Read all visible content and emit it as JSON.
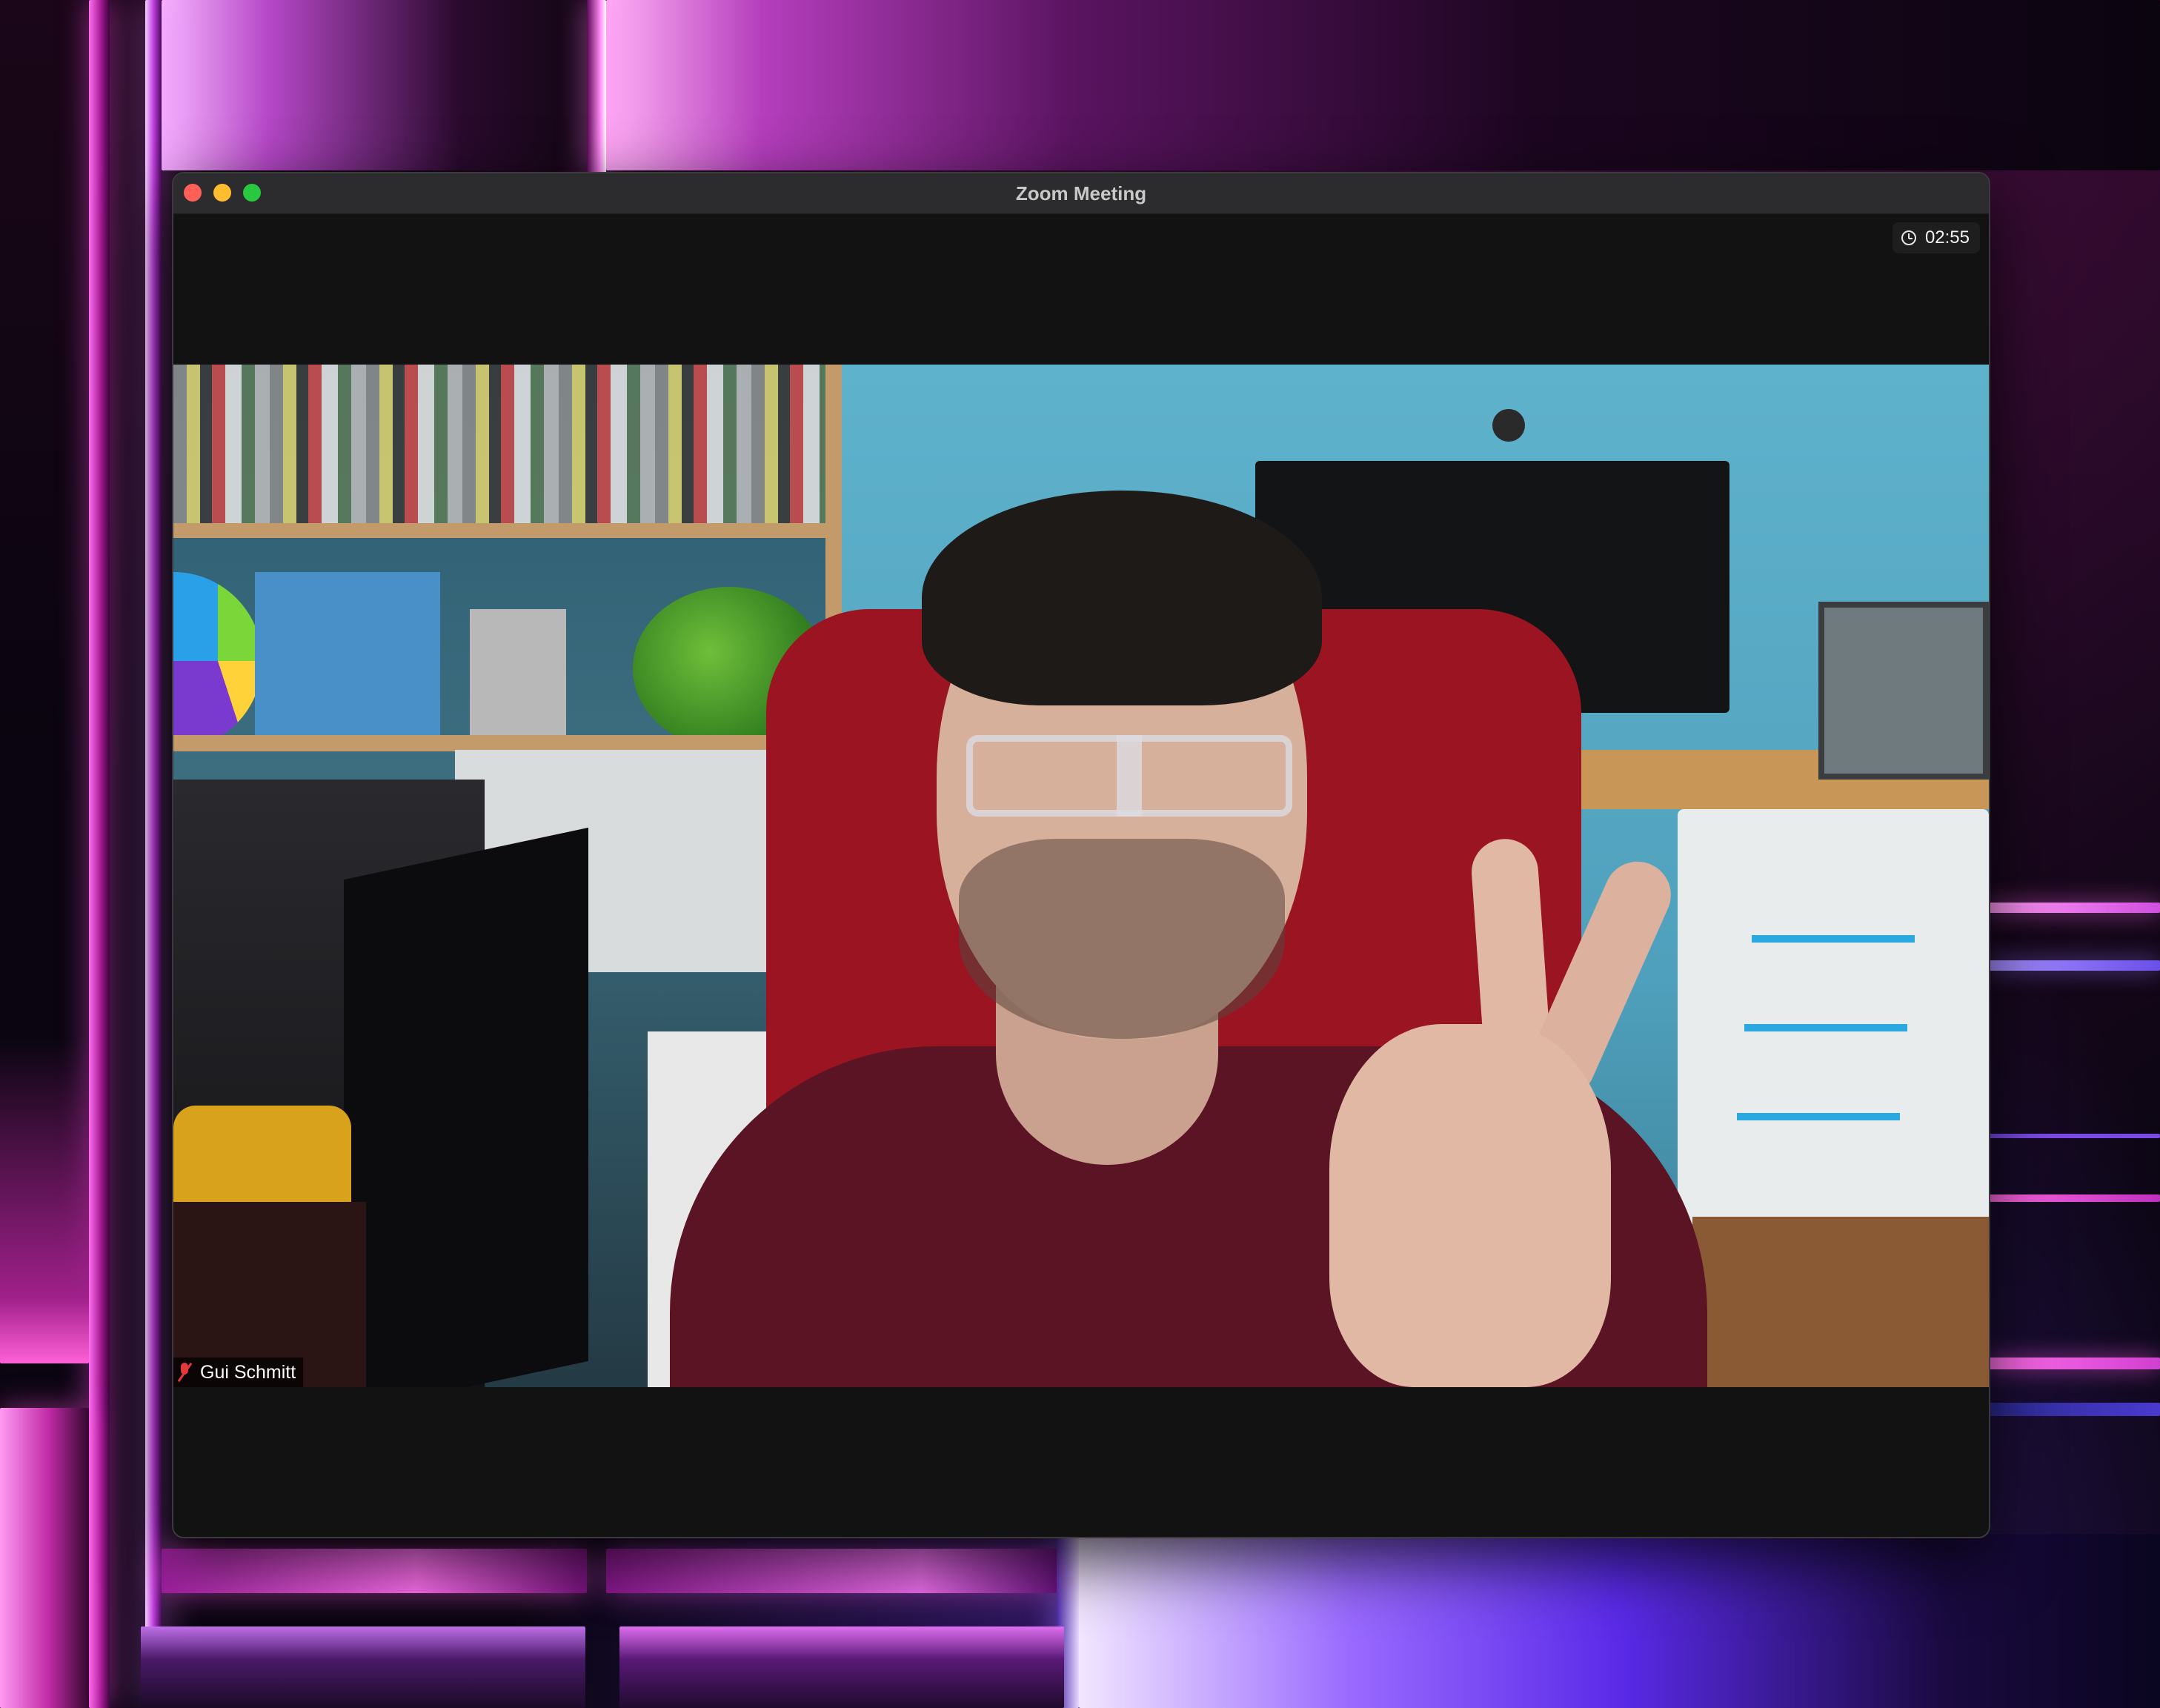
{
  "window": {
    "title": "Zoom Meeting"
  },
  "meeting": {
    "timer": "02:55",
    "timer_icon": "clock-icon"
  },
  "participant": {
    "name": "Gui Schmitt",
    "mic_status_icon": "mic-muted-icon",
    "mic_muted": true
  },
  "colors": {
    "window_background": "#121212",
    "titlebar": "#2c2c2e",
    "close": "#ff5f57",
    "minimize": "#febc2e",
    "maximize": "#28c840",
    "muted_mic": "#e23a3a"
  }
}
